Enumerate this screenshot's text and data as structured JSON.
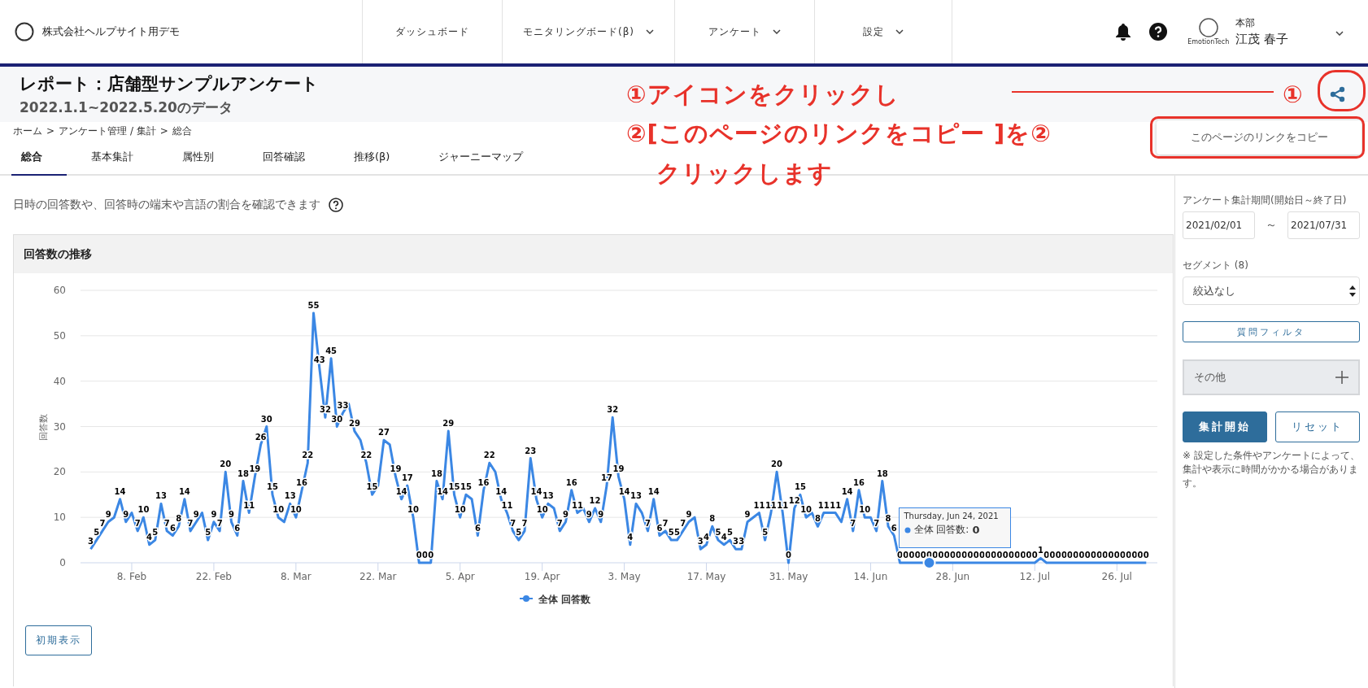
{
  "header": {
    "company": "株式会社ヘルプサイト用デモ",
    "nav": [
      {
        "label": "ダッシュボード",
        "dropdown": false
      },
      {
        "label": "モニタリングボード(β)",
        "dropdown": true
      },
      {
        "label": "アンケート",
        "dropdown": true
      },
      {
        "label": "設定",
        "dropdown": true
      }
    ],
    "user": {
      "avatar_caption": "EmotionTech",
      "department": "本部",
      "name": "江茂 春子"
    }
  },
  "report": {
    "title": "レポート：店舗型サンプルアンケート",
    "subtitle": "2022.1.1~2022.5.20のデータ"
  },
  "share_menu": {
    "item": "このページのリンクをコピー"
  },
  "breadcrumb": {
    "separator": ">",
    "items": [
      "ホーム",
      "アンケート管理 / 集計",
      "総合"
    ]
  },
  "tabs": [
    {
      "label": "総合",
      "selected": true
    },
    {
      "label": "基本集計",
      "selected": false
    },
    {
      "label": "属性別",
      "selected": false
    },
    {
      "label": "回答確認",
      "selected": false
    },
    {
      "label": "推移(β)",
      "selected": false
    },
    {
      "label": "ジャーニーマップ",
      "selected": false
    }
  ],
  "description": "日時の回答数や、回答時の端末や言語の割合を確認できます",
  "chart_panel": {
    "title": "回答数の推移",
    "reset_button": "初期表示",
    "tooltip": {
      "date": "Thursday, Jun 24, 2021",
      "series": "全体 回答数:",
      "value": "0"
    },
    "chart_data": {
      "type": "line",
      "ylabel": "回答数",
      "ylim": [
        0,
        60
      ],
      "yticks": [
        0,
        10,
        20,
        30,
        40,
        50,
        60
      ],
      "grid": true,
      "categories": [
        null,
        null,
        null,
        null,
        null,
        null,
        null,
        "8. Feb",
        null,
        null,
        null,
        null,
        null,
        null,
        null,
        null,
        null,
        null,
        null,
        null,
        null,
        "22. Feb",
        null,
        null,
        null,
        null,
        null,
        null,
        null,
        null,
        null,
        null,
        null,
        null,
        null,
        "8. Mar",
        null,
        null,
        null,
        null,
        null,
        null,
        null,
        null,
        null,
        null,
        null,
        null,
        null,
        "22. Mar",
        null,
        null,
        null,
        null,
        null,
        null,
        null,
        null,
        null,
        null,
        null,
        null,
        null,
        "5. Apr",
        null,
        null,
        null,
        null,
        null,
        null,
        null,
        null,
        null,
        null,
        null,
        null,
        null,
        "19. Apr",
        null,
        null,
        null,
        null,
        null,
        null,
        null,
        null,
        null,
        null,
        null,
        null,
        null,
        "3. May",
        null,
        null,
        null,
        null,
        null,
        null,
        null,
        null,
        null,
        null,
        null,
        null,
        null,
        "17. May",
        null,
        null,
        null,
        null,
        null,
        null,
        null,
        null,
        null,
        null,
        null,
        null,
        null,
        "31. May",
        null,
        null,
        null,
        null,
        null,
        null,
        null,
        null,
        null,
        null,
        null,
        null,
        null,
        "14. Jun",
        null,
        null,
        null,
        null,
        null,
        null,
        null,
        null,
        null,
        null,
        null,
        null,
        null,
        "28. Jun",
        null,
        null,
        null,
        null,
        null,
        null,
        null,
        null,
        null,
        null,
        null,
        null,
        null,
        "12. Jul",
        null,
        null,
        null,
        null,
        null,
        null,
        null,
        null,
        null,
        null,
        null,
        null,
        null,
        "26. Jul",
        null,
        null,
        null,
        null,
        null
      ],
      "value_labels": [
        "3",
        "5",
        "7",
        "9",
        null,
        "14",
        "9",
        null,
        "7",
        "10",
        "4",
        "5",
        "13",
        "7",
        "6",
        "8",
        "14",
        "7",
        "9",
        null,
        "5",
        "9",
        "7",
        "20",
        "9",
        "6",
        "18",
        "11",
        "19",
        "26",
        "30",
        "15",
        "10",
        null,
        "13",
        "10",
        "16",
        "22",
        "55",
        "43",
        "32",
        "45",
        "30",
        "33",
        null,
        "29",
        null,
        "22",
        "15",
        null,
        "27",
        null,
        "19",
        "14",
        "17",
        "10",
        "0",
        "0",
        "0",
        "18",
        "14",
        "29",
        "15",
        "10",
        "15",
        null,
        "6",
        "16",
        "22",
        null,
        "14",
        "11",
        "7",
        "5",
        "7",
        "23",
        "14",
        "10",
        "13",
        null,
        "7",
        "9",
        "16",
        "11",
        null,
        "9",
        "12",
        "9",
        "17",
        "32",
        "19",
        "14",
        "4",
        "13",
        null,
        "7",
        "14",
        "6",
        "7",
        "5",
        "5",
        "7",
        "9",
        null,
        "3",
        "4",
        "8",
        "5",
        "4",
        "5",
        "3",
        "3",
        "9",
        null,
        "11",
        "5",
        "11",
        "20",
        "11",
        "0",
        "12",
        "15",
        "10",
        null,
        "8",
        "11",
        null,
        "11",
        null,
        "14",
        "7",
        "16",
        "10",
        null,
        "7",
        "18",
        "8",
        "6",
        "0",
        "0",
        "0",
        "0",
        "0",
        "0",
        "0",
        "0",
        "0",
        "0",
        "0",
        "0",
        "0",
        "0",
        "0",
        "0",
        "0",
        "0",
        "0",
        "0",
        "0",
        "0",
        "0",
        "0",
        "1",
        "0",
        "0",
        "0",
        "0",
        "0",
        "0",
        "0",
        "0",
        "0",
        "0",
        "0",
        "0",
        "0",
        "0",
        "0",
        "0",
        "0",
        "0"
      ],
      "series": [
        {
          "name": "全体 回答数",
          "color": "#3b87e4",
          "values": [
            3,
            5,
            7,
            9,
            10,
            14,
            9,
            11,
            7,
            10,
            4,
            5,
            13,
            7,
            6,
            8,
            14,
            7,
            9,
            11,
            5,
            9,
            7,
            20,
            9,
            6,
            18,
            11,
            19,
            26,
            30,
            15,
            10,
            9,
            13,
            10,
            16,
            22,
            55,
            43,
            32,
            45,
            30,
            33,
            35,
            29,
            27,
            22,
            15,
            17,
            27,
            26,
            19,
            14,
            17,
            10,
            0,
            0,
            0,
            18,
            14,
            29,
            15,
            10,
            15,
            14,
            6,
            16,
            22,
            20,
            14,
            11,
            7,
            5,
            7,
            23,
            14,
            10,
            13,
            12,
            7,
            9,
            16,
            11,
            12,
            9,
            12,
            9,
            17,
            32,
            19,
            14,
            4,
            13,
            11,
            7,
            14,
            6,
            7,
            5,
            5,
            7,
            9,
            10,
            3,
            4,
            8,
            5,
            4,
            5,
            3,
            3,
            9,
            10,
            11,
            5,
            11,
            20,
            11,
            0,
            12,
            15,
            10,
            11,
            8,
            11,
            11,
            11,
            9,
            14,
            7,
            16,
            10,
            10,
            7,
            18,
            8,
            6,
            0,
            0,
            0,
            0,
            0,
            0,
            0,
            0,
            0,
            0,
            0,
            0,
            0,
            0,
            0,
            0,
            0,
            0,
            0,
            0,
            0,
            0,
            0,
            0,
            1,
            0,
            0,
            0,
            0,
            0,
            0,
            0,
            0,
            0,
            0,
            0,
            0,
            0,
            0,
            0,
            0,
            0,
            0
          ]
        }
      ]
    }
  },
  "sidebar": {
    "period_label": "アンケート集計期間(開始日～終了日)",
    "start_date": "2021/02/01",
    "range_separator": "～",
    "end_date": "2021/07/31",
    "segment_label": "セグメント (8)",
    "segment_value": "絞込なし",
    "filter_button": "質問フィルタ",
    "other_section": {
      "label": "その他",
      "expanded": false
    },
    "run_button": "集計開始",
    "reset_button": "リセット",
    "note": "※ 設定した条件やアンケートによって、集計や表示に時間がかかる場合があります。"
  },
  "callouts": [
    {
      "kind": "step",
      "text": "①アイコンをクリックし"
    },
    {
      "kind": "marker",
      "text": "①"
    },
    {
      "kind": "step",
      "text": "②[このページのリンクをコピー ]を②"
    },
    {
      "kind": "continuation",
      "text": "クリックします"
    }
  ]
}
